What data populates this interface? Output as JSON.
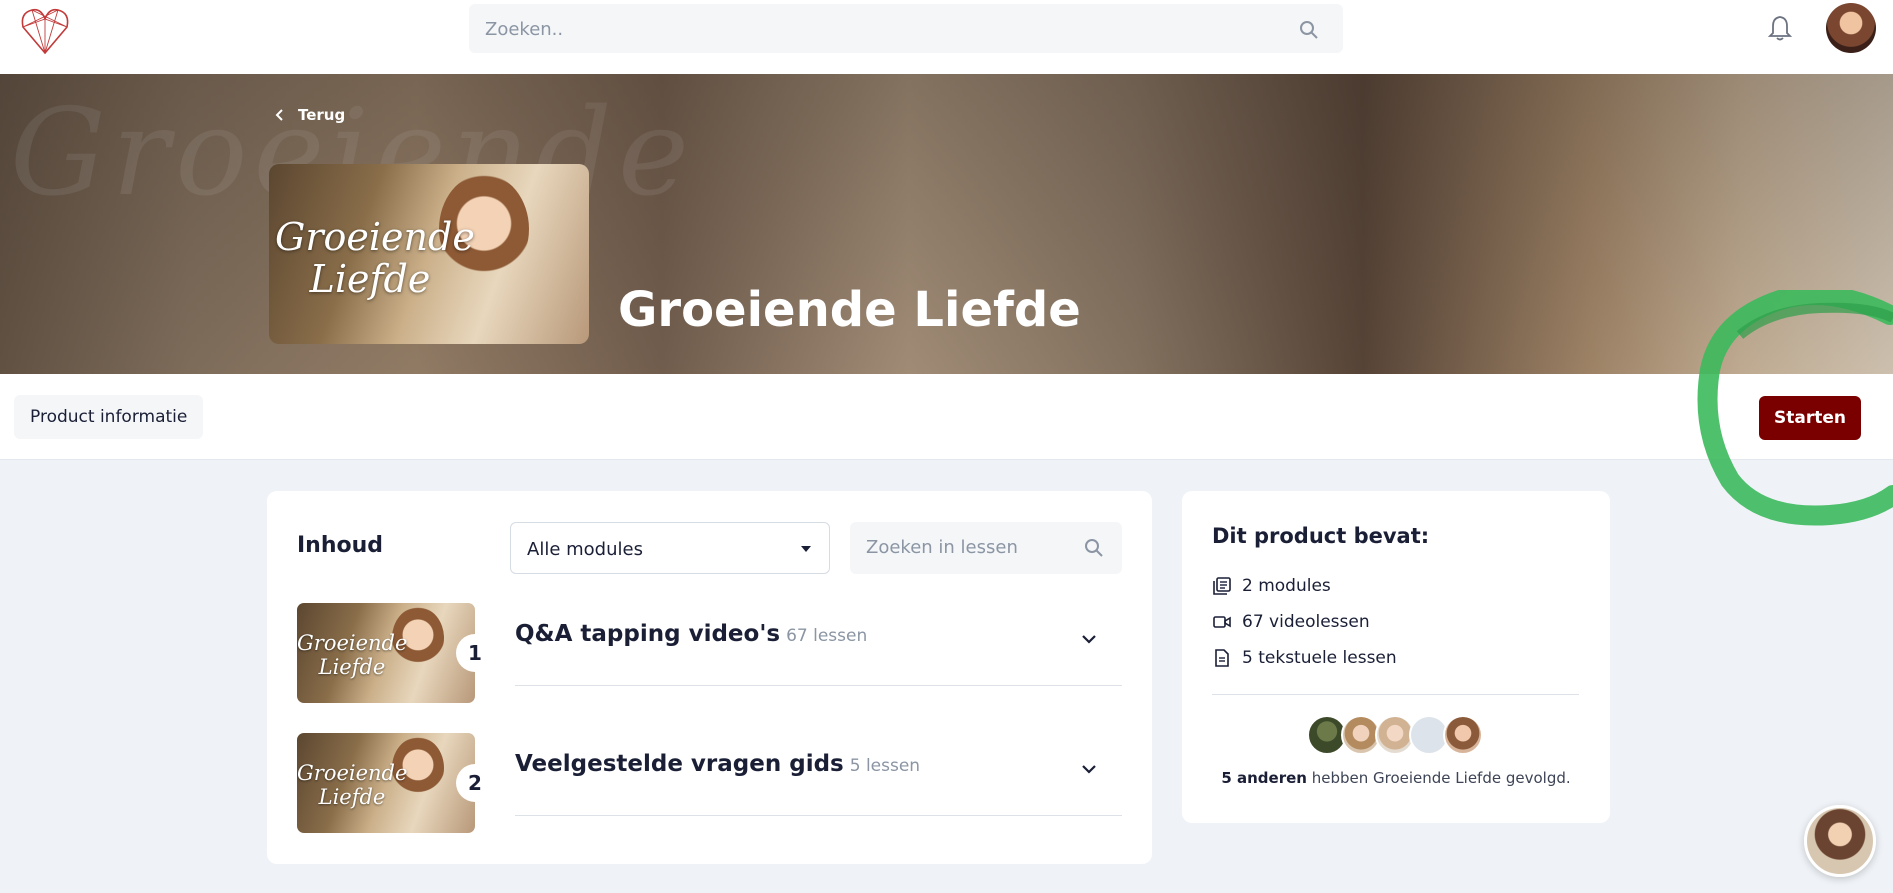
{
  "nav": {
    "search_placeholder": "Zoeken..",
    "logo_icon": "heart-logo-icon",
    "bell_icon": "bell-icon"
  },
  "hero": {
    "back_label": "Terug",
    "cover_text": "Groeiende Liefde",
    "title": "Groeiende Liefde"
  },
  "subbar": {
    "tab_label": "Product informatie",
    "start_label": "Starten"
  },
  "content": {
    "heading": "Inhoud",
    "module_filter": "Alle modules",
    "lesson_search_placeholder": "Zoeken in lessen",
    "modules": [
      {
        "number": "1",
        "title": "Q&A tapping video's",
        "count": "67 lessen",
        "thumb_text": "Groeiende Liefde"
      },
      {
        "number": "2",
        "title": "Veelgestelde vragen gids",
        "count": "5 lessen",
        "thumb_text": "Groeiende Liefde"
      }
    ]
  },
  "side": {
    "title": "Dit product bevat:",
    "items": [
      {
        "icon": "modules-icon",
        "label": "2 modules"
      },
      {
        "icon": "video-icon",
        "label": "67 videolessen"
      },
      {
        "icon": "document-icon",
        "label": "5 tekstuele lessen"
      }
    ],
    "followers_bold": "5 anderen",
    "followers_rest": " hebben Groeiende Liefde gevolgd."
  },
  "colors": {
    "start_button": "#7a0000",
    "annotation": "#3cb95c",
    "background": "#eff3f7"
  }
}
